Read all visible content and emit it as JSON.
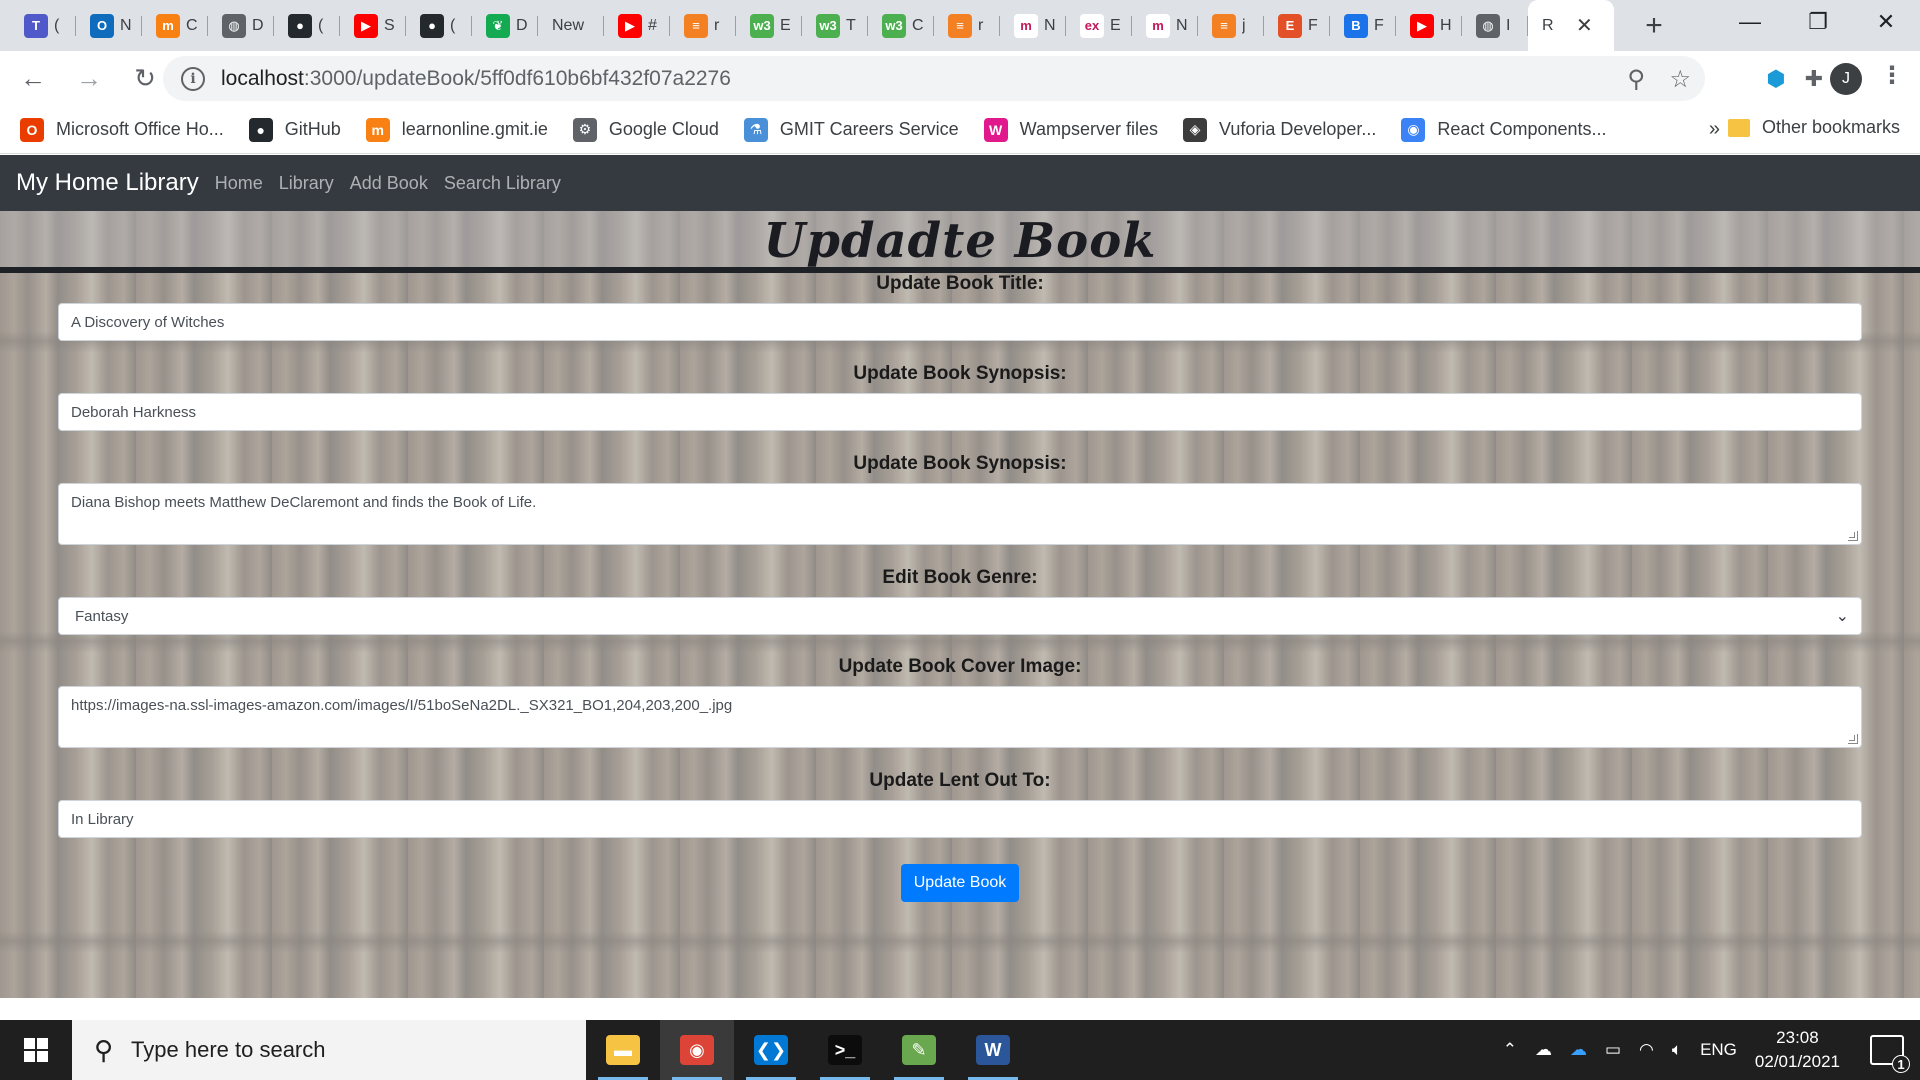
{
  "browser": {
    "tabs": [
      {
        "icon": "teams-icon",
        "label": "(",
        "color": "#5059c9",
        "glyph": "T"
      },
      {
        "icon": "outlook-icon",
        "label": "N",
        "color": "#0f6cbd",
        "glyph": "O"
      },
      {
        "icon": "moodle-icon",
        "label": "C",
        "color": "#f98012",
        "glyph": "m"
      },
      {
        "icon": "globe-icon",
        "label": "D",
        "color": "#5f6368",
        "glyph": "◍"
      },
      {
        "icon": "github-icon",
        "label": "(",
        "color": "#24292e",
        "glyph": "●"
      },
      {
        "icon": "youtube-icon",
        "label": "S",
        "color": "#ff0000",
        "glyph": "▶"
      },
      {
        "icon": "github-icon",
        "label": "(",
        "color": "#24292e",
        "glyph": "●"
      },
      {
        "icon": "mongodb-icon",
        "label": "D",
        "color": "#13aa52",
        "glyph": "❦"
      },
      {
        "icon": "new-tab-icon",
        "label": "New",
        "color": "#dee1e6",
        "glyph": ""
      },
      {
        "icon": "youtube-icon",
        "label": "#",
        "color": "#ff0000",
        "glyph": "▶"
      },
      {
        "icon": "stackoverflow-icon",
        "label": "r",
        "color": "#f48024",
        "glyph": "≡"
      },
      {
        "icon": "w3schools-icon",
        "label": "E",
        "color": "#4caf50",
        "glyph": "w3"
      },
      {
        "icon": "w3schools-icon",
        "label": "T",
        "color": "#4caf50",
        "glyph": "w3"
      },
      {
        "icon": "w3schools-icon",
        "label": "C",
        "color": "#4caf50",
        "glyph": "w3"
      },
      {
        "icon": "stackoverflow-icon",
        "label": "r",
        "color": "#f48024",
        "glyph": "≡"
      },
      {
        "icon": "mdn-icon",
        "label": "N",
        "color": "#ffffff",
        "glyph": "m"
      },
      {
        "icon": "expo-icon",
        "label": "E",
        "color": "#ffffff",
        "glyph": "ex"
      },
      {
        "icon": "mdn-icon",
        "label": "N",
        "color": "#ffffff",
        "glyph": "m"
      },
      {
        "icon": "stackoverflow-icon",
        "label": "j",
        "color": "#f48024",
        "glyph": "≡"
      },
      {
        "icon": "codeacademy-icon",
        "label": "F",
        "color": "#e34f26",
        "glyph": "E"
      },
      {
        "icon": "firebase-icon",
        "label": "F",
        "color": "#1a73e8",
        "glyph": "B"
      },
      {
        "icon": "youtube-icon",
        "label": "H",
        "color": "#ff0000",
        "glyph": "▶"
      },
      {
        "icon": "globe-icon",
        "label": "I",
        "color": "#5f6368",
        "glyph": "◍"
      }
    ],
    "active_tab": {
      "label": "R",
      "close": "✕"
    },
    "new_tab": "+",
    "window_controls": {
      "minimize": "—",
      "restore": "❐",
      "close": "✕"
    },
    "url_host": "localhost",
    "url_path": ":3000/updateBook/5ff0df610b6bf432f07a2276",
    "profile_initial": "J",
    "bookmarks": [
      {
        "label": "Microsoft Office Ho...",
        "icon": "office-icon",
        "color": "#eb3c00",
        "glyph": "O"
      },
      {
        "label": "GitHub",
        "icon": "github-icon",
        "color": "#24292e",
        "glyph": "●"
      },
      {
        "label": "learnonline.gmit.ie",
        "icon": "moodle-icon",
        "color": "#f98012",
        "glyph": "m"
      },
      {
        "label": "Google Cloud",
        "icon": "gear-icon",
        "color": "#5f6368",
        "glyph": "⚙"
      },
      {
        "label": "GMIT Careers Service",
        "icon": "flask-icon",
        "color": "#4a90d9",
        "glyph": "⚗"
      },
      {
        "label": "Wampserver files",
        "icon": "wamp-icon",
        "color": "#e0198d",
        "glyph": "W"
      },
      {
        "label": "Vuforia Developer...",
        "icon": "vuforia-icon",
        "color": "#3c3c3c",
        "glyph": "◈"
      },
      {
        "label": "React Components...",
        "icon": "react-icon",
        "color": "#3b82f6",
        "glyph": "◉"
      }
    ],
    "bookmarks_more": "»",
    "other_bookmarks": "Other bookmarks"
  },
  "app": {
    "brand": "My Home Library",
    "nav": [
      "Home",
      "Library",
      "Add Book",
      "Search Library"
    ],
    "page_title": "Updadte Book",
    "form": {
      "title_label": "Update Book Title:",
      "title_value": "A Discovery of Witches",
      "author_label": "Update Book Synopsis:",
      "author_value": "Deborah Harkness",
      "synopsis_label": "Update Book Synopsis:",
      "synopsis_value": "Diana Bishop meets Matthew DeClaremont and finds the Book of Life.",
      "genre_label": "Edit Book Genre:",
      "genre_value": "Fantasy",
      "cover_label": "Update Book Cover Image:",
      "cover_value": "https://images-na.ssl-images-amazon.com/images/I/51boSeNa2DL._SX321_BO1,204,203,200_.jpg",
      "lent_label": "Update Lent Out To:",
      "lent_value": "In Library",
      "submit_label": "Update Book"
    }
  },
  "taskbar": {
    "search_placeholder": "Type here to search",
    "apps": [
      {
        "icon": "file-explorer-icon",
        "color": "#f6c343",
        "glyph": "▬",
        "active": false
      },
      {
        "icon": "chrome-icon",
        "color": "#db4437",
        "glyph": "◉",
        "active": true
      },
      {
        "icon": "vscode-icon",
        "color": "#0078d4",
        "glyph": "❮❯",
        "active": false
      },
      {
        "icon": "terminal-icon",
        "color": "#0c0c0c",
        "glyph": ">_",
        "active": false
      },
      {
        "icon": "paint-icon",
        "color": "#6aa84f",
        "glyph": "✎",
        "active": false
      },
      {
        "icon": "word-icon",
        "color": "#2b579a",
        "glyph": "W",
        "active": false
      }
    ],
    "language": "ENG",
    "time": "23:08",
    "date": "02/01/2021",
    "notifications": "1"
  }
}
